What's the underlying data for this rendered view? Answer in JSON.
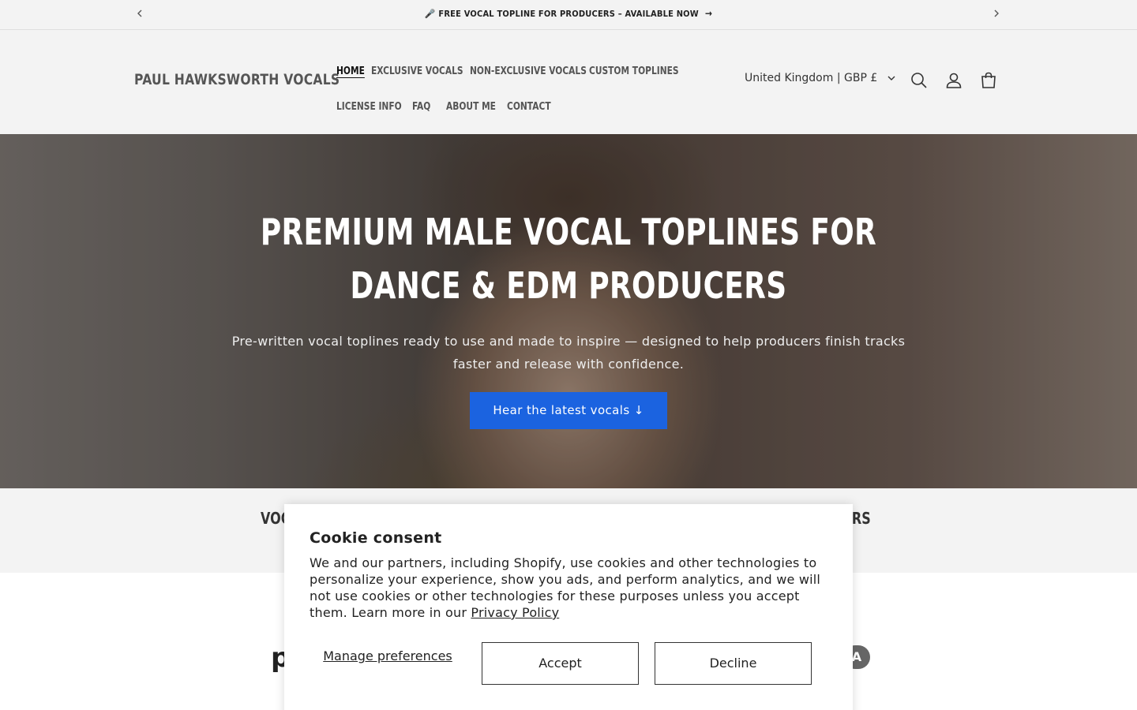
{
  "announcement": {
    "prev_icon": "chevron-left-icon",
    "message": "🎤 FREE VOCAL TOPLINE FOR PRODUCERS – AVAILABLE NOW",
    "message_arrow": "→",
    "next_icon": "chevron-right-icon"
  },
  "header": {
    "logo": "PAUL HAWKSWORTH VOCALS",
    "nav_row1": [
      "HOME",
      "EXCLUSIVE VOCALS",
      "NON-EXCLUSIVE VOCALS",
      "CUSTOM TOPLINES"
    ],
    "nav_row2": [
      "LICENSE INFO",
      "FAQ",
      "ABOUT ME",
      "CONTACT"
    ],
    "active_item": "HOME",
    "country_selector": "United Kingdom | GBP £",
    "icons": [
      "search-icon",
      "account-icon",
      "cart-icon"
    ]
  },
  "hero": {
    "title": "PREMIUM MALE VOCAL TOPLINES FOR DANCE & EDM PRODUCERS",
    "subtitle": "Pre-written vocal toplines ready to use and made to inspire — designed to help producers finish tracks faster and release with confidence.",
    "cta": "Hear the latest vocals ↓",
    "cta_color": "#1b63e0"
  },
  "strip": {
    "left_text": "VOC",
    "right_text": "ERS"
  },
  "below": {
    "left_logo_fragment": "p",
    "right_logo_fragment": "A"
  },
  "cookie": {
    "title": "Cookie consent",
    "body": "We and our partners, including Shopify, use cookies and other technologies to personalize your experience, show you ads, and perform analytics, and we will not use cookies or other technologies for these purposes unless you accept them. Learn more in our ",
    "privacy_link": "Privacy Policy",
    "manage": "Manage preferences",
    "accept": "Accept",
    "decline": "Decline"
  }
}
